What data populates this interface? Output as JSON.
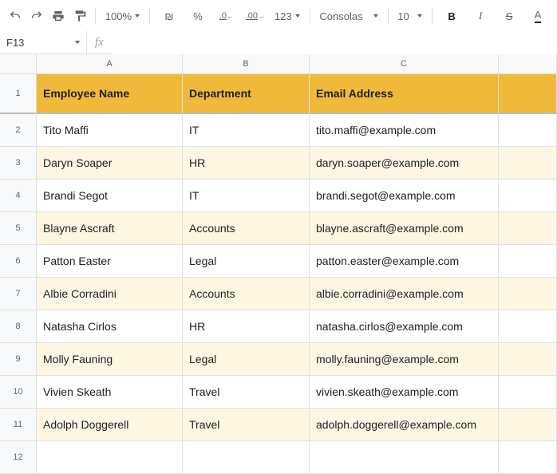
{
  "toolbar": {
    "zoom": "100%",
    "currency_sign": "₪",
    "percent": "%",
    "dec_decrease": ".0",
    "dec_increase": ".00",
    "more_formats": "123",
    "font": "Consolas",
    "font_size": "10",
    "bold": "B",
    "italic": "I",
    "strike": "S",
    "text_color": "A"
  },
  "namebox": {
    "ref": "F13",
    "fx": "fx"
  },
  "columns": [
    "A",
    "B",
    "C",
    ""
  ],
  "chart_data": {
    "type": "table",
    "headers": [
      "Employee Name",
      "Department",
      "Email Address"
    ],
    "rows": [
      [
        "Tito Maffi",
        "IT",
        "tito.maffi@example.com"
      ],
      [
        "Daryn Soaper",
        "HR",
        "daryn.soaper@example.com"
      ],
      [
        "Brandi Segot",
        "IT",
        "brandi.segot@example.com"
      ],
      [
        "Blayne Ascraft",
        "Accounts",
        "blayne.ascraft@example.com"
      ],
      [
        "Patton Easter",
        "Legal",
        "patton.easter@example.com"
      ],
      [
        "Albie Corradini",
        "Accounts",
        "albie.corradini@example.com"
      ],
      [
        "Natasha Cirlos",
        "HR",
        "natasha.cirlos@example.com"
      ],
      [
        "Molly Fauning",
        "Legal",
        "molly.fauning@example.com"
      ],
      [
        "Vivien Skeath",
        "Travel",
        "vivien.skeath@example.com"
      ],
      [
        "Adolph Doggerell",
        "Travel",
        "adolph.doggerell@example.com"
      ]
    ]
  },
  "row_numbers": [
    "1",
    "2",
    "3",
    "4",
    "5",
    "6",
    "7",
    "8",
    "9",
    "10",
    "11",
    "12"
  ]
}
